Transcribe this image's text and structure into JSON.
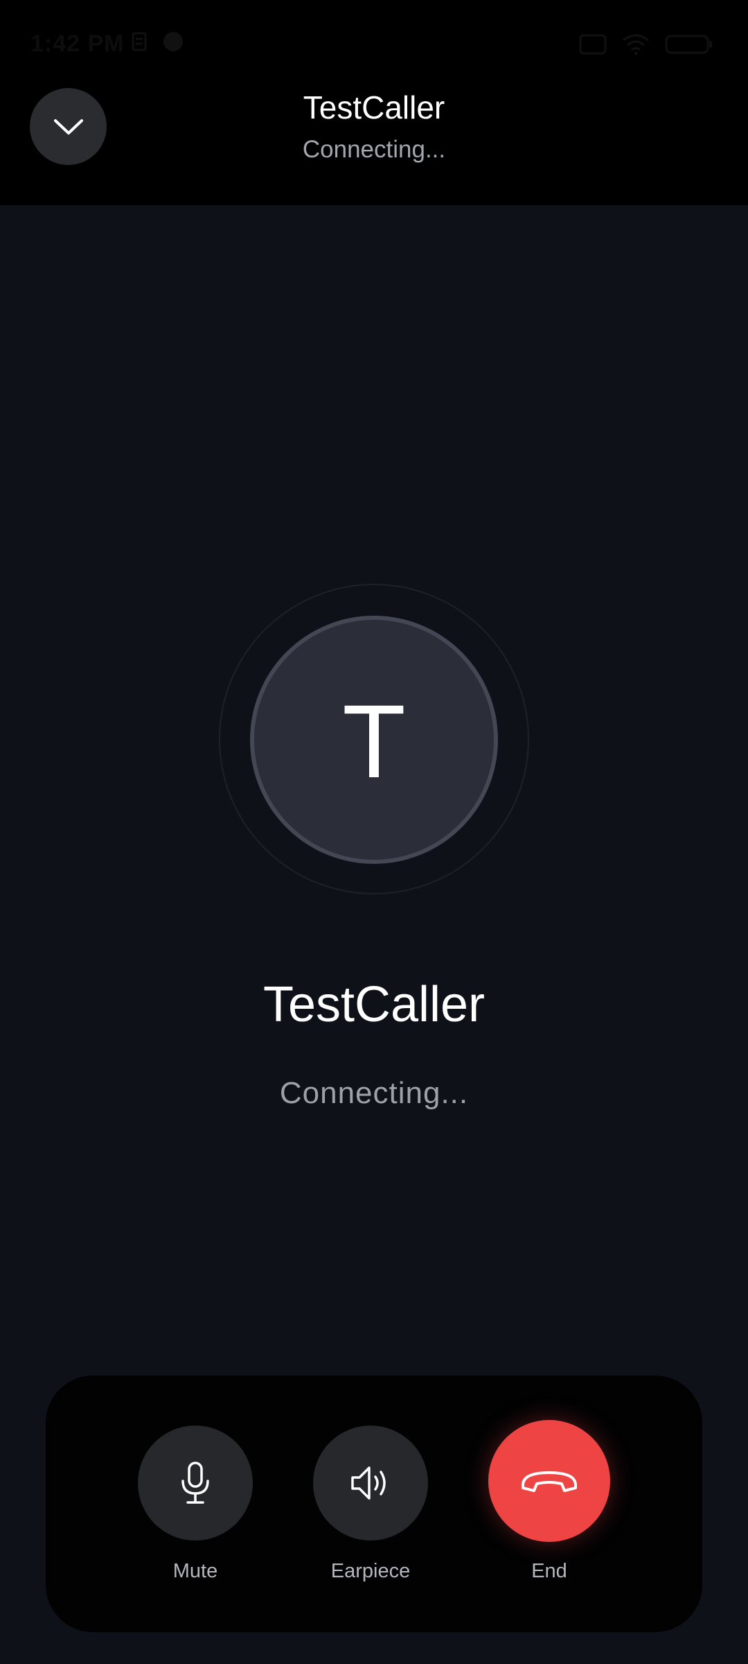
{
  "status_bar": {
    "time": "1:42 PM",
    "icons": [
      "notification-icon",
      "app-notification-icon",
      "sim-icon",
      "wifi-icon",
      "battery-icon"
    ]
  },
  "header": {
    "title": "TestCaller",
    "status": "Connecting...",
    "collapse_icon": "chevron-down-icon"
  },
  "caller": {
    "initial": "T",
    "name": "TestCaller",
    "status": "Connecting..."
  },
  "controls": {
    "mute": {
      "label": "Mute",
      "icon": "microphone-icon"
    },
    "earpiece": {
      "label": "Earpiece",
      "icon": "speaker-icon"
    },
    "end": {
      "label": "End",
      "icon": "phone-hangup-icon",
      "color": "#ef4444"
    }
  },
  "colors": {
    "background": "#0e1118",
    "header_background": "#000000",
    "end_call": "#ef4444",
    "button_background": "#27282c"
  }
}
